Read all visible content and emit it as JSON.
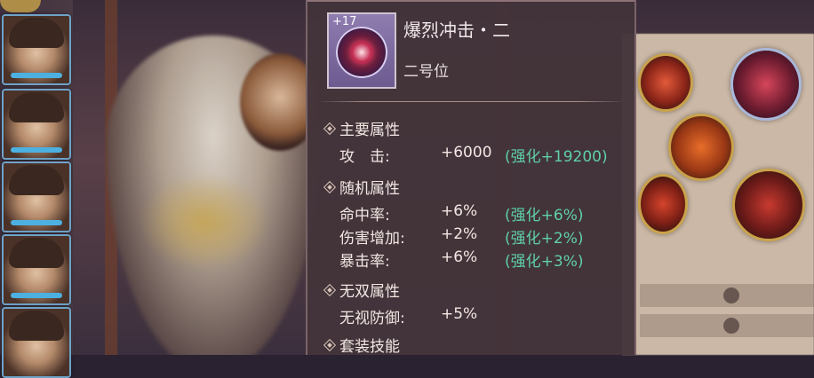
{
  "item": {
    "level": "+17",
    "name": "爆烈冲击・二",
    "slot": "二号位"
  },
  "sections": [
    {
      "title": "主要属性",
      "stats": [
        {
          "label": "攻　击:",
          "value": "+6000",
          "bonus": "(强化+19200)"
        }
      ]
    },
    {
      "title": "随机属性",
      "stats": [
        {
          "label": "命中率:",
          "value": "+6%",
          "bonus": "(强化+6%)"
        },
        {
          "label": "伤害增加:",
          "value": "+2%",
          "bonus": "(强化+2%)"
        },
        {
          "label": "暴击率:",
          "value": "+6%",
          "bonus": "(强化+3%)"
        }
      ]
    },
    {
      "title": "无双属性",
      "stats": [
        {
          "label": "无视防御:",
          "value": "+5%",
          "bonus": ""
        }
      ]
    },
    {
      "title": "套装技能",
      "stats": []
    }
  ],
  "colors": {
    "panel_bg": "#43343a",
    "bonus_text": "#5fd0a8",
    "text": "#f1e7e3"
  }
}
